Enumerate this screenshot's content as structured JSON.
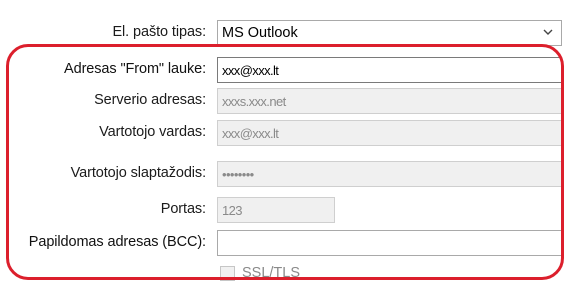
{
  "email_type": {
    "label": "El. pašto tipas:",
    "value": "MS Outlook"
  },
  "from_address": {
    "label": "Adresas \"From\" lauke:",
    "value": "xxx@xxx.lt"
  },
  "server_address": {
    "label": "Serverio adresas:",
    "value": "xxxs.xxx.net"
  },
  "username": {
    "label": "Vartotojo vardas:",
    "value": "xxx@xxx.lt"
  },
  "password": {
    "label": "Vartotojo slaptažodis:",
    "value": "••••••••"
  },
  "port": {
    "label": "Portas:",
    "value": "123"
  },
  "bcc": {
    "label": "Papildomas adresas (BCC):",
    "value": ""
  },
  "ssl": {
    "label": "SSL/TLS",
    "checked": false
  },
  "colors": {
    "highlight": "#dc1f2c",
    "disabled_bg": "#f0f0f0",
    "disabled_text": "#8a8a8a"
  },
  "icons": {
    "dropdown": "chevron-down-icon"
  }
}
